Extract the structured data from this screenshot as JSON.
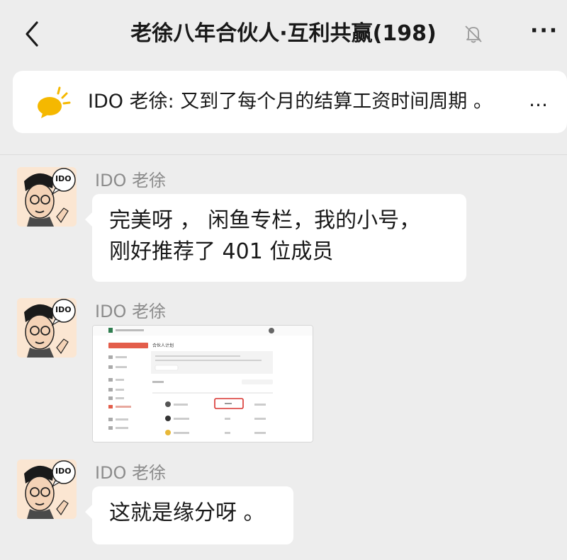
{
  "header": {
    "title": "老徐八年合伙人·互利共赢(198)",
    "back_icon": "back-chevron-icon",
    "mute_icon": "muted-bell-icon",
    "more_label": "···"
  },
  "notice": {
    "icon": "megaphone-icon",
    "text": "IDO 老徐: 又到了每个月的结算工资时间周期 。",
    "more_label": "…",
    "icon_color": "#f5b800"
  },
  "messages": [
    {
      "sender": "IDO 老徐",
      "lines": [
        "完美呀 ， 闲鱼专栏，我的小号，",
        "刚好推荐了 401 位成员"
      ]
    },
    {
      "sender": "IDO 老徐",
      "image_title": "合伙人计划",
      "highlight_color": "#d9322e"
    },
    {
      "sender": "IDO 老徐",
      "lines": [
        "这就是缘分呀 。"
      ]
    }
  ],
  "avatar_badge": "IDO"
}
